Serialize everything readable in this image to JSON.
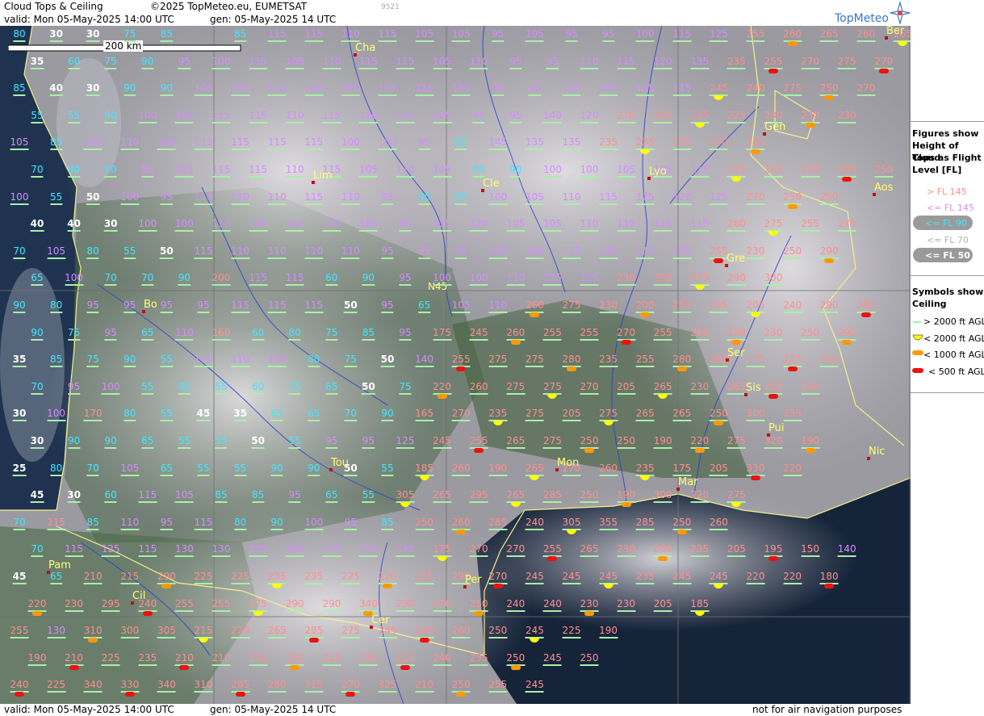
{
  "header": {
    "title": "Cloud Tops & Ceiling",
    "copyright": "©2025 TopMeteo.eu, EUMETSAT",
    "code": "9521",
    "valid": "valid:  Mon  05-May-2025  14:00 UTC",
    "gen": "gen: 05-May-2025 14 UTC",
    "brand": "TopMeteo"
  },
  "footer": {
    "valid": "valid:  Mon  05-May-2025  14:00 UTC",
    "gen": "gen: 05-May-2025 14 UTC",
    "note": "not for air navigation purposes"
  },
  "scale_label": "200 km",
  "lat_label": "N45",
  "legend": {
    "tops_title": [
      "Figures show",
      "Height of Cloud",
      "Tops as Flight",
      "Level  [FL]"
    ],
    "tops_items": [
      "> FL 145",
      "<= FL 145",
      "<= FL 90",
      "<= FL 70",
      "<= FL 50"
    ],
    "ceiling_title": [
      "Symbols show",
      "Ceiling"
    ],
    "ceiling_items": [
      "> 2000 ft AGL",
      "< 2000 ft AGL",
      "< 1000 ft AGL",
      "< 500 ft AGL"
    ],
    "colors": {
      "gt145": "#ff8f8f",
      "le145": "#d68cff",
      "le90": "#40e8ff",
      "le70": "#c8c8c8",
      "le50": "#ffffff",
      "ceil_hi": "#a8f0a8",
      "ceil_2000": "#ffff00",
      "ceil_1000": "#ff9900",
      "ceil_500": "#ee1111"
    }
  },
  "cities": [
    "Cha",
    "Lim",
    "Cle",
    "Lyo",
    "Gen",
    "Aos",
    "Gre",
    "Bo",
    "Ser",
    "Sis",
    "Pui",
    "Nic",
    "Mon",
    "Mar",
    "Tou",
    "Pam",
    "Cil",
    "Per",
    "Cer",
    "Ber"
  ],
  "grid": {
    "rows": [
      [
        "80",
        "30",
        "30",
        "75",
        "85",
        "",
        "85",
        "115",
        "115",
        "110",
        "115",
        "105",
        "105",
        "95",
        "105",
        "95",
        "95",
        "100",
        "115",
        "125",
        "255",
        "260",
        "265",
        "260",
        "265"
      ],
      [
        "35",
        "60",
        "75",
        "90",
        "95",
        "100",
        "115",
        "105",
        "110",
        "115",
        "115",
        "105",
        "110",
        "95",
        "95",
        "110",
        "115",
        "120",
        "135",
        "235",
        "255",
        "270",
        "275",
        "270",
        "265"
      ],
      [
        "85",
        "40",
        "30",
        "90",
        "90",
        "100",
        "115",
        "115",
        "115",
        "115",
        "105",
        "115",
        "105",
        "95",
        "95",
        "120",
        "125",
        "125",
        "115",
        "245",
        "240",
        "275",
        "250",
        "270"
      ],
      [
        "55",
        "55",
        "90",
        "100",
        "105",
        "115",
        "115",
        "110",
        "115",
        "110",
        "125",
        "105",
        "95",
        "95",
        "140",
        "120",
        "210",
        "230",
        "235",
        "225",
        "230",
        "230",
        "230"
      ],
      [
        "105",
        "85",
        "100",
        "110",
        "110",
        "115",
        "115",
        "115",
        "115",
        "100",
        "100",
        "95",
        "85",
        "145",
        "135",
        "135",
        "235",
        "235",
        "255",
        "270",
        "260"
      ],
      [
        "70",
        "80",
        "90",
        "95",
        "105",
        "115",
        "115",
        "110",
        "115",
        "105",
        "110",
        "105",
        "90",
        "90",
        "100",
        "100",
        "105",
        "105",
        "115",
        "235",
        "265",
        "230",
        "300",
        "250"
      ],
      [
        "100",
        "55",
        "50",
        "100",
        "95",
        "110",
        "110",
        "110",
        "115",
        "110",
        "95",
        "90",
        "85",
        "100",
        "105",
        "110",
        "115",
        "125",
        "120",
        "125",
        "270",
        "250",
        "250"
      ],
      [
        "40",
        "40",
        "30",
        "100",
        "100",
        "110",
        "110",
        "110",
        "100",
        "105",
        "95",
        "115",
        "120",
        "105",
        "105",
        "110",
        "110",
        "125",
        "115",
        "260",
        "275",
        "255",
        "270"
      ],
      [
        "70",
        "105",
        "80",
        "55",
        "50",
        "115",
        "110",
        "110",
        "110",
        "110",
        "95",
        "95",
        "95",
        "100",
        "100",
        "115",
        "115",
        "115",
        "100",
        "255",
        "230",
        "250",
        "290"
      ],
      [
        "65",
        "100",
        "70",
        "70",
        "90",
        "200",
        "115",
        "115",
        "60",
        "90",
        "95",
        "100",
        "100",
        "110",
        "125",
        "125",
        "230",
        "230",
        "275",
        "290",
        "300"
      ],
      [
        "90",
        "80",
        "95",
        "95",
        "95",
        "95",
        "115",
        "115",
        "115",
        "50",
        "95",
        "65",
        "105",
        "110",
        "260",
        "275",
        "230",
        "200",
        "255",
        "205",
        "205",
        "240",
        "290",
        "285"
      ],
      [
        "90",
        "75",
        "95",
        "65",
        "110",
        "160",
        "60",
        "80",
        "75",
        "85",
        "95",
        "175",
        "245",
        "260",
        "255",
        "255",
        "270",
        "255",
        "260",
        "230",
        "230",
        "250",
        "290"
      ],
      [
        "35",
        "85",
        "75",
        "90",
        "55",
        "100",
        "110",
        "100",
        "80",
        "75",
        "50",
        "140",
        "255",
        "275",
        "275",
        "280",
        "235",
        "255",
        "280",
        "260",
        "175",
        "225",
        "250"
      ],
      [
        "70",
        "95",
        "100",
        "55",
        "85",
        "55",
        "60",
        "75",
        "65",
        "50",
        "75",
        "220",
        "260",
        "275",
        "275",
        "270",
        "205",
        "265",
        "230",
        "265",
        "255",
        "240"
      ],
      [
        "30",
        "100",
        "170",
        "80",
        "55",
        "45",
        "35",
        "65",
        "65",
        "70",
        "90",
        "165",
        "270",
        "235",
        "275",
        "205",
        "275",
        "265",
        "265",
        "250",
        "300",
        "235"
      ],
      [
        "30",
        "90",
        "90",
        "65",
        "55",
        "55",
        "50",
        "55",
        "95",
        "95",
        "125",
        "245",
        "255",
        "265",
        "275",
        "250",
        "250",
        "190",
        "220",
        "275",
        "320",
        "190"
      ],
      [
        "25",
        "80",
        "70",
        "105",
        "65",
        "55",
        "55",
        "90",
        "90",
        "50",
        "55",
        "185",
        "260",
        "190",
        "265",
        "270",
        "260",
        "235",
        "175",
        "205",
        "330",
        "220"
      ],
      [
        "45",
        "30",
        "60",
        "115",
        "105",
        "85",
        "85",
        "95",
        "65",
        "55",
        "305",
        "265",
        "295",
        "265",
        "285",
        "250",
        "190",
        "300",
        "220",
        "275"
      ],
      [
        "70",
        "215",
        "85",
        "110",
        "95",
        "115",
        "80",
        "90",
        "100",
        "95",
        "85",
        "250",
        "260",
        "285",
        "240",
        "305",
        "355",
        "285",
        "250",
        "260"
      ],
      [
        "70",
        "115",
        "125",
        "115",
        "130",
        "130",
        "125",
        "130",
        "130",
        "125",
        "130",
        "175",
        "270",
        "270",
        "255",
        "265",
        "230",
        "260",
        "235",
        "205",
        "195",
        "150",
        "140"
      ],
      [
        "45",
        "65",
        "210",
        "215",
        "290",
        "225",
        "225",
        "235",
        "235",
        "225",
        "220",
        "215",
        "290",
        "270",
        "245",
        "245",
        "245",
        "235",
        "245",
        "245",
        "220",
        "220",
        "180"
      ],
      [
        "220",
        "230",
        "295",
        "240",
        "255",
        "255",
        "275",
        "290",
        "290",
        "340",
        "230",
        "270",
        "250",
        "240",
        "240",
        "230",
        "230",
        "205",
        "185"
      ],
      [
        "255",
        "130",
        "310",
        "300",
        "305",
        "215",
        "220",
        "265",
        "285",
        "275",
        "245",
        "240",
        "260",
        "250",
        "245",
        "225",
        "190"
      ],
      [
        "190",
        "210",
        "225",
        "235",
        "210",
        "210",
        "210",
        "250",
        "215",
        "215",
        "210",
        "240",
        "255",
        "250",
        "245",
        "250"
      ],
      [
        "240",
        "225",
        "340",
        "330",
        "340",
        "310",
        "285",
        "280",
        "315",
        "270",
        "325",
        "210",
        "250",
        "255",
        "245"
      ]
    ],
    "symbols": [
      "y",
      "o",
      "r",
      "g"
    ]
  }
}
